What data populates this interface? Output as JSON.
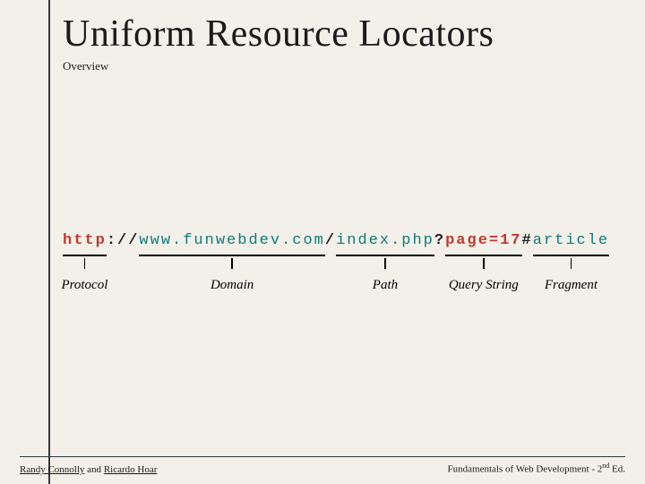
{
  "title": "Uniform Resource Locators",
  "subtitle": "Overview",
  "url_parts": {
    "protocol_scheme": "http",
    "colon": ":",
    "slashes": "//",
    "domain": "www.funwebdev.com",
    "slash": "/",
    "path": "index.php",
    "qmark": "?",
    "query": "page=17",
    "hash": "#",
    "fragment": "article"
  },
  "labels": {
    "protocol": "Protocol",
    "domain": "Domain",
    "path": "Path",
    "query": "Query String",
    "fragment": "Fragment"
  },
  "footer": {
    "left_pre": "Randy Connolly",
    "left_mid": " and ",
    "left_post": "Ricardo Hoar",
    "right_pre": "Fundamentals of Web Development - 2",
    "right_sup": "nd",
    "right_post": " Ed."
  }
}
